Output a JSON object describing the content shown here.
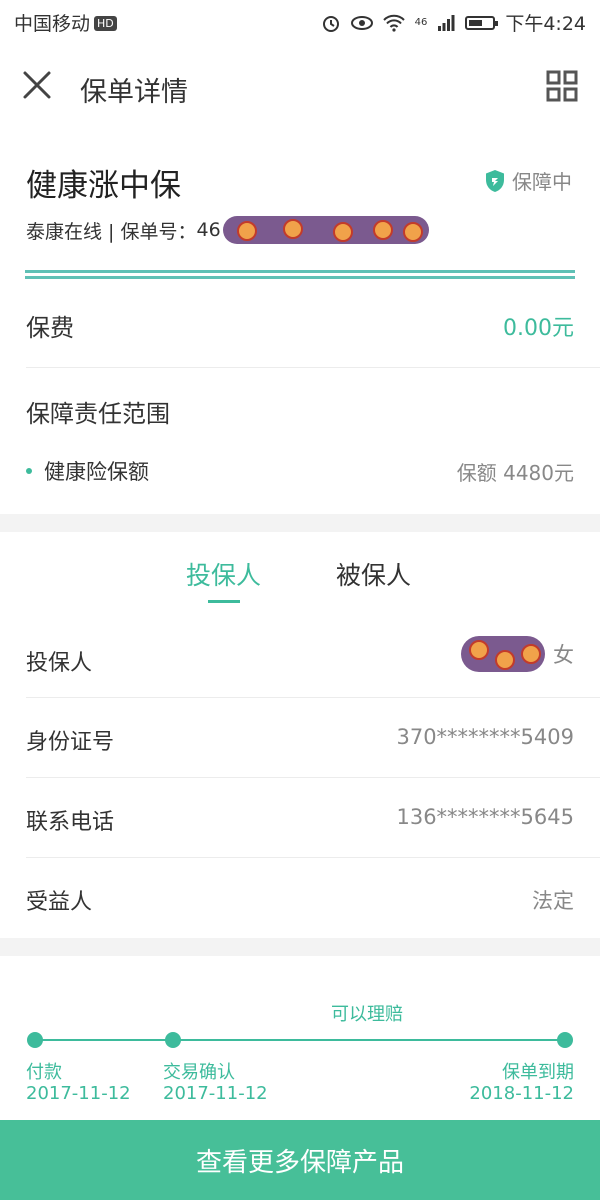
{
  "status_bar": {
    "carrier": "中国移动",
    "hd_badge": "HD",
    "network": "46",
    "time": "下午4:24",
    "battery_level": 0.6
  },
  "header": {
    "title": "保单详情",
    "close_icon": "close-icon",
    "menu_icon": "grid-icon"
  },
  "policy": {
    "product_name": "健康涨中保",
    "status": "保障中",
    "insurer_prefix": "泰康在线 | 保单号：",
    "policy_no_visible": "46"
  },
  "premium": {
    "label": "保费",
    "value": "0.00元"
  },
  "coverage": {
    "title": "保障责任范围",
    "items": [
      {
        "name": "健康险保额",
        "amount": "保额 4480元"
      }
    ]
  },
  "tabs": [
    {
      "label": "投保人",
      "active": true
    },
    {
      "label": "被保人",
      "active": false
    }
  ],
  "holder_info": {
    "holder": {
      "label": "投保人",
      "gender": "女"
    },
    "id_number": {
      "label": "身份证号",
      "value": "370********5409"
    },
    "phone": {
      "label": "联系电话",
      "value": "136********5645"
    },
    "beneficiary": {
      "label": "受益人",
      "value": "法定"
    }
  },
  "timeline": {
    "claim_label": "可以理赔",
    "steps": [
      {
        "label": "付款",
        "date": "2017-11-12"
      },
      {
        "label": "交易确认",
        "date": "2017-11-12"
      },
      {
        "label": "保单到期",
        "date": "2018-11-12"
      }
    ]
  },
  "cta": {
    "label": "查看更多保障产品"
  },
  "colors": {
    "accent": "#3dbb9c",
    "button": "#47bf98",
    "redaction": "#7b5a8f"
  }
}
